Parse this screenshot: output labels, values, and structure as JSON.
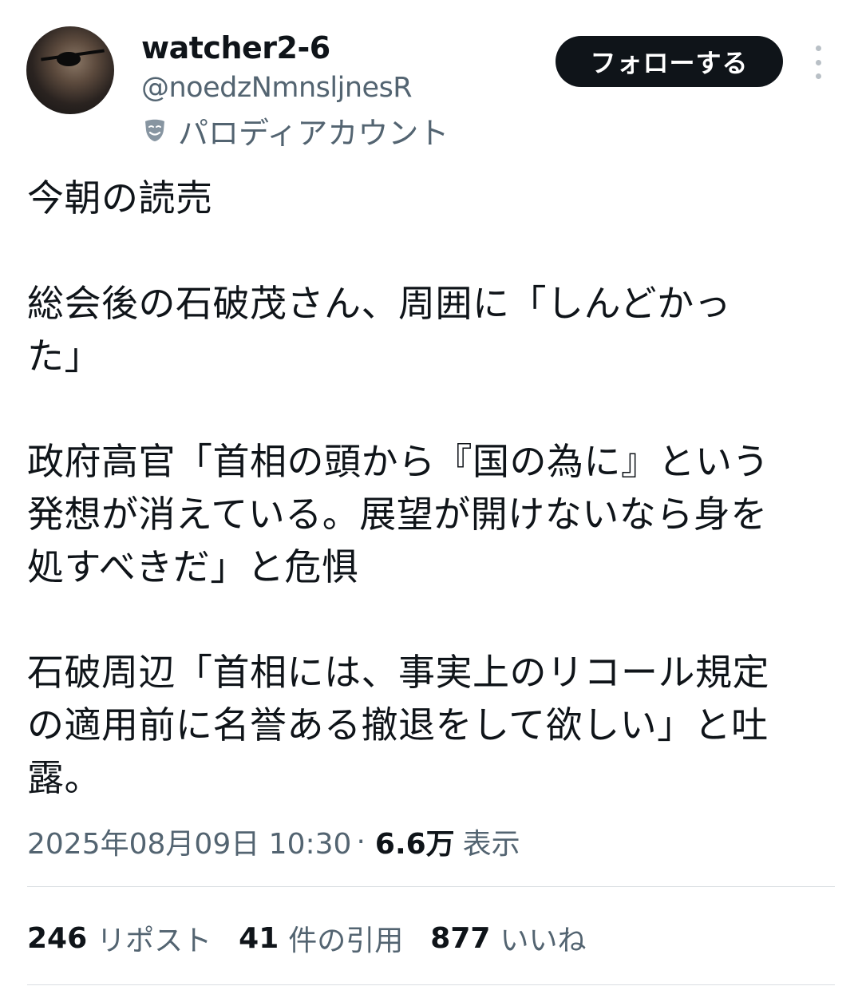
{
  "user": {
    "name": "watcher2-6",
    "handle": "@noedzNmnsljnesR",
    "parody_label": "パロディアカウント"
  },
  "follow_button_label": "フォローする",
  "tweet": {
    "lines": [
      "今朝の読売",
      "",
      "総会後の石破茂さん、周囲に「しんどかっ",
      "た」",
      "",
      "政府高官「首相の頭から『国の為に』という",
      "発想が消えている。展望が開けないなら身を",
      "処すべきだ」と危惧",
      "",
      "石破周辺「首相には、事実上のリコール規定",
      "の適用前に名誉ある撤退をして欲しい」と吐",
      "露。"
    ]
  },
  "meta": {
    "timestamp": "2025年08月09日 10:30",
    "separator": "·",
    "views_count": "6.6万",
    "views_label": "表示"
  },
  "stats": {
    "reposts": {
      "count": "246",
      "label": "リポスト"
    },
    "quotes": {
      "count": "41",
      "label": "件の引用"
    },
    "likes": {
      "count": "877",
      "label": "いいね"
    }
  },
  "icons": {
    "parody": "theater-mask-icon",
    "more": "more-vertical-icon"
  },
  "colors": {
    "text_primary": "#0f1419",
    "text_secondary": "#536471",
    "follow_bg": "#0f1419",
    "divider": "#d9dee2"
  }
}
